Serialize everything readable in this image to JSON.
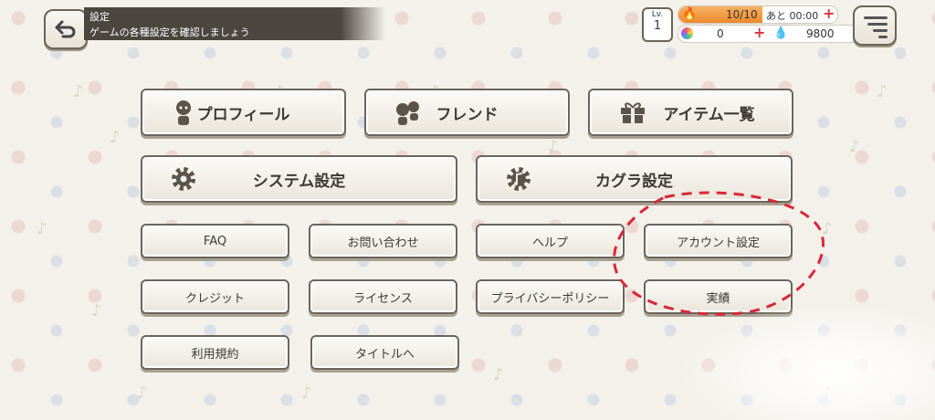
{
  "header": {
    "title": "設定",
    "subtitle": "ゲームの各種設定を確認しましょう"
  },
  "status": {
    "level_label": "Lv.",
    "level_value": "1",
    "stamina": "10/10",
    "stamina_timer": "あと 00:00",
    "gems": "0",
    "coins": "9800"
  },
  "menu": {
    "profile": "プロフィール",
    "friends": "フレンド",
    "items": "アイテム一覧",
    "system_settings": "システム設定",
    "kagura_settings": "カグラ設定",
    "faq": "FAQ",
    "contact": "お問い合わせ",
    "help": "ヘルプ",
    "account_settings": "アカウント設定",
    "credits": "クレジット",
    "license": "ライセンス",
    "privacy_policy": "プライバシーポリシー",
    "achievements": "実績",
    "terms": "利用規約",
    "to_title": "タイトルへ"
  },
  "colors": {
    "annotation": "#d8283a",
    "stamina_fill": "#ee8a2c",
    "button_border": "#6b665d"
  }
}
